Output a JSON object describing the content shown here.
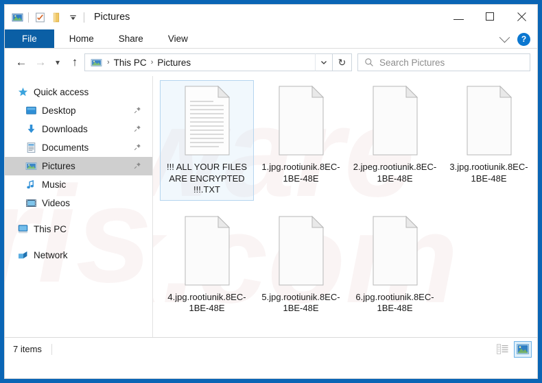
{
  "window": {
    "title": "Pictures",
    "quick_access_icons": [
      "picture-icon",
      "properties-icon",
      "new-folder-icon",
      "customize-dropdown-icon"
    ],
    "controls": {
      "minimize": "minimize-icon",
      "maximize": "maximize-icon",
      "close": "close-icon"
    }
  },
  "ribbon": {
    "tabs": [
      {
        "label": "File",
        "active": true
      },
      {
        "label": "Home",
        "active": false
      },
      {
        "label": "Share",
        "active": false
      },
      {
        "label": "View",
        "active": false
      }
    ],
    "expand_icon": "chevron-down-icon",
    "help_label": "?"
  },
  "navigation": {
    "back_icon": "arrow-left-icon",
    "forward_icon": "arrow-right-icon",
    "recent_icon": "chevron-down-icon",
    "up_icon": "arrow-up-icon",
    "breadcrumb": {
      "location_icon": "pictures-icon",
      "parts": [
        "This PC",
        "Pictures"
      ],
      "separator": "›"
    },
    "address_dropdown_icon": "chevron-down-icon",
    "refresh_icon": "refresh-icon",
    "refresh_glyph": "↻"
  },
  "search": {
    "icon": "search-icon",
    "placeholder": "Search Pictures",
    "value": ""
  },
  "sidebar": {
    "items": [
      {
        "label": "Quick access",
        "icon": "star-icon",
        "indent": false,
        "pinned": false,
        "selected": false
      },
      {
        "label": "Desktop",
        "icon": "desktop-icon",
        "indent": true,
        "pinned": true,
        "selected": false
      },
      {
        "label": "Downloads",
        "icon": "download-icon",
        "indent": true,
        "pinned": true,
        "selected": false
      },
      {
        "label": "Documents",
        "icon": "documents-icon",
        "indent": true,
        "pinned": true,
        "selected": false
      },
      {
        "label": "Pictures",
        "icon": "pictures-icon",
        "indent": true,
        "pinned": true,
        "selected": true
      },
      {
        "label": "Music",
        "icon": "music-icon",
        "indent": true,
        "pinned": false,
        "selected": false
      },
      {
        "label": "Videos",
        "icon": "videos-icon",
        "indent": true,
        "pinned": false,
        "selected": false
      },
      {
        "label": "This PC",
        "icon": "thispc-icon",
        "indent": false,
        "pinned": false,
        "selected": false,
        "gap_before": true
      },
      {
        "label": "Network",
        "icon": "network-icon",
        "indent": false,
        "pinned": false,
        "selected": false,
        "gap_before": true
      }
    ],
    "pin_glyph": "📌"
  },
  "files": [
    {
      "name": "!!! ALL YOUR FILES ARE ENCRYPTED !!!.TXT",
      "icon": "text-document-icon",
      "selected": true
    },
    {
      "name": "1.jpg.rootiunik.8EC-1BE-48E",
      "icon": "blank-document-icon",
      "selected": false
    },
    {
      "name": "2.jpeg.rootiunik.8EC-1BE-48E",
      "icon": "blank-document-icon",
      "selected": false
    },
    {
      "name": "3.jpg.rootiunik.8EC-1BE-48E",
      "icon": "blank-document-icon",
      "selected": false
    },
    {
      "name": "4.jpg.rootiunik.8EC-1BE-48E",
      "icon": "blank-document-icon",
      "selected": false
    },
    {
      "name": "5.jpg.rootiunik.8EC-1BE-48E",
      "icon": "blank-document-icon",
      "selected": false
    },
    {
      "name": "6.jpg.rootiunik.8EC-1BE-48E",
      "icon": "blank-document-icon",
      "selected": false
    }
  ],
  "statusbar": {
    "count_text": "7 items",
    "views": [
      {
        "name": "details-view-button",
        "active": false
      },
      {
        "name": "large-icons-view-button",
        "active": true
      }
    ]
  },
  "watermark": {
    "text": "pcrisk.com",
    "color": "#f3e6e6"
  },
  "colors": {
    "accent": "#0b5fa5",
    "window_bg": "#0a65b5",
    "selection": "#b4d5ef",
    "sidebar_selected": "#cfcfcf"
  }
}
